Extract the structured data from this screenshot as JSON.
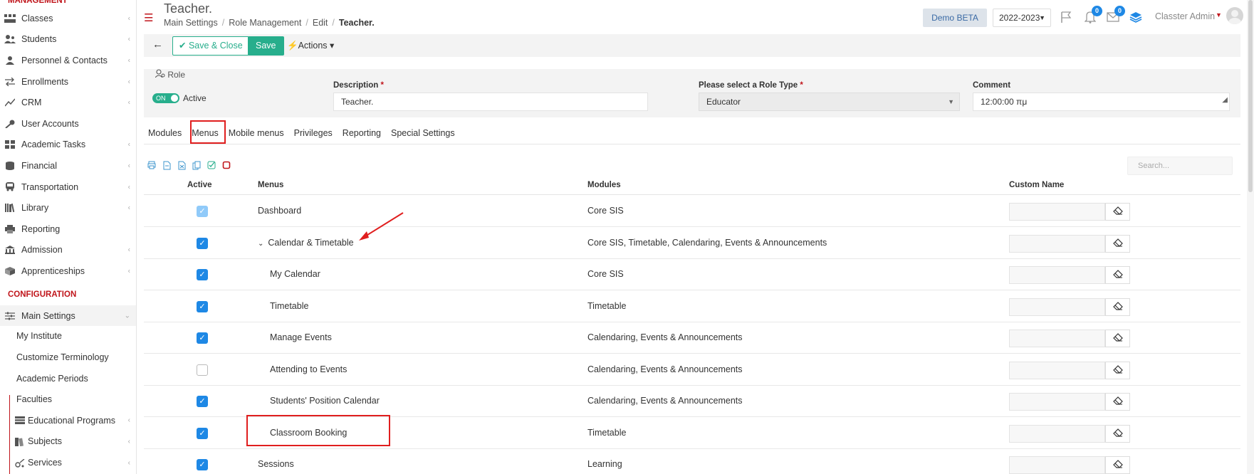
{
  "sidebar": {
    "section_management": "MANAGEMENT",
    "management_items": [
      {
        "label": "Classes",
        "icon": "classes-icon",
        "chevron": true
      },
      {
        "label": "Students",
        "icon": "students-icon",
        "chevron": true
      },
      {
        "label": "Personnel & Contacts",
        "icon": "personnel-icon",
        "chevron": true
      },
      {
        "label": "Enrollments",
        "icon": "enrollments-icon",
        "chevron": true
      },
      {
        "label": "CRM",
        "icon": "crm-icon",
        "chevron": true
      },
      {
        "label": "User Accounts",
        "icon": "key-icon",
        "chevron": false
      },
      {
        "label": "Academic Tasks",
        "icon": "tasks-icon",
        "chevron": true
      },
      {
        "label": "Financial",
        "icon": "financial-icon",
        "chevron": true
      },
      {
        "label": "Transportation",
        "icon": "bus-icon",
        "chevron": true
      },
      {
        "label": "Library",
        "icon": "library-icon",
        "chevron": true
      },
      {
        "label": "Reporting",
        "icon": "printer-icon",
        "chevron": false
      },
      {
        "label": "Admission",
        "icon": "admission-icon",
        "chevron": true
      },
      {
        "label": "Apprenticeships",
        "icon": "apprenticeships-icon",
        "chevron": true
      }
    ],
    "section_configuration": "CONFIGURATION",
    "main_settings": "Main Settings",
    "sub_items": [
      {
        "label": "My Institute"
      },
      {
        "label": "Customize Terminology"
      },
      {
        "label": "Academic Periods"
      },
      {
        "label": "Faculties"
      },
      {
        "label": "Educational Programs"
      },
      {
        "label": "Subjects"
      },
      {
        "label": "Services"
      }
    ]
  },
  "header": {
    "title": "Teacher.",
    "breadcrumb": [
      "Main Settings",
      "Role Management",
      "Edit",
      "Teacher."
    ],
    "demo_badge": "Demo BETA",
    "year": "2022-2023",
    "notifications_count": "0",
    "messages_count": "0",
    "user": "Classter Admin"
  },
  "toolbar": {
    "save_close": "✔ Save & Close",
    "save": "Save",
    "actions": "⚡Actions ▾"
  },
  "form": {
    "role_label": "Role",
    "toggle": "ON",
    "active_label": "Active",
    "description_label": "Description",
    "description_value": "Teacher.",
    "role_type_label": "Please select a Role Type",
    "role_type_value": "Educator",
    "comment_label": "Comment",
    "comment_value": "12:00:00 πμ",
    "required_mark": "*"
  },
  "tabs": [
    "Modules",
    "Menus",
    "Mobile menus",
    "Privileges",
    "Reporting",
    "Special Settings"
  ],
  "search_placeholder": "Search...",
  "table": {
    "headers": {
      "active": "Active",
      "menus": "Menus",
      "modules": "Modules",
      "custom_name": "Custom Name"
    },
    "rows": [
      {
        "menu": "Dashboard",
        "module": "Core SIS",
        "state": "dim",
        "child": false,
        "expander": false
      },
      {
        "menu": "Calendar & Timetable",
        "module": "Core SIS, Timetable, Calendaring, Events & Announcements",
        "state": "on",
        "child": false,
        "expander": true
      },
      {
        "menu": "My Calendar",
        "module": "Core SIS",
        "state": "on",
        "child": true,
        "expander": false
      },
      {
        "menu": "Timetable",
        "module": "Timetable",
        "state": "on",
        "child": true,
        "expander": false
      },
      {
        "menu": "Manage Events",
        "module": "Calendaring, Events & Announcements",
        "state": "on",
        "child": true,
        "expander": false
      },
      {
        "menu": "Attending to Events",
        "module": "Calendaring, Events & Announcements",
        "state": "off",
        "child": true,
        "expander": false
      },
      {
        "menu": "Students' Position Calendar",
        "module": "Calendaring, Events & Announcements",
        "state": "on",
        "child": true,
        "expander": false
      },
      {
        "menu": "Classroom Booking",
        "module": "Timetable",
        "state": "on",
        "child": true,
        "expander": false
      },
      {
        "menu": "Sessions",
        "module": "Learning",
        "state": "on",
        "child": false,
        "expander": false
      }
    ]
  },
  "colors": {
    "accent_red": "#c0151b",
    "green": "#27ae8c",
    "blue": "#1e88e5",
    "annotation": "#e01e1e"
  }
}
